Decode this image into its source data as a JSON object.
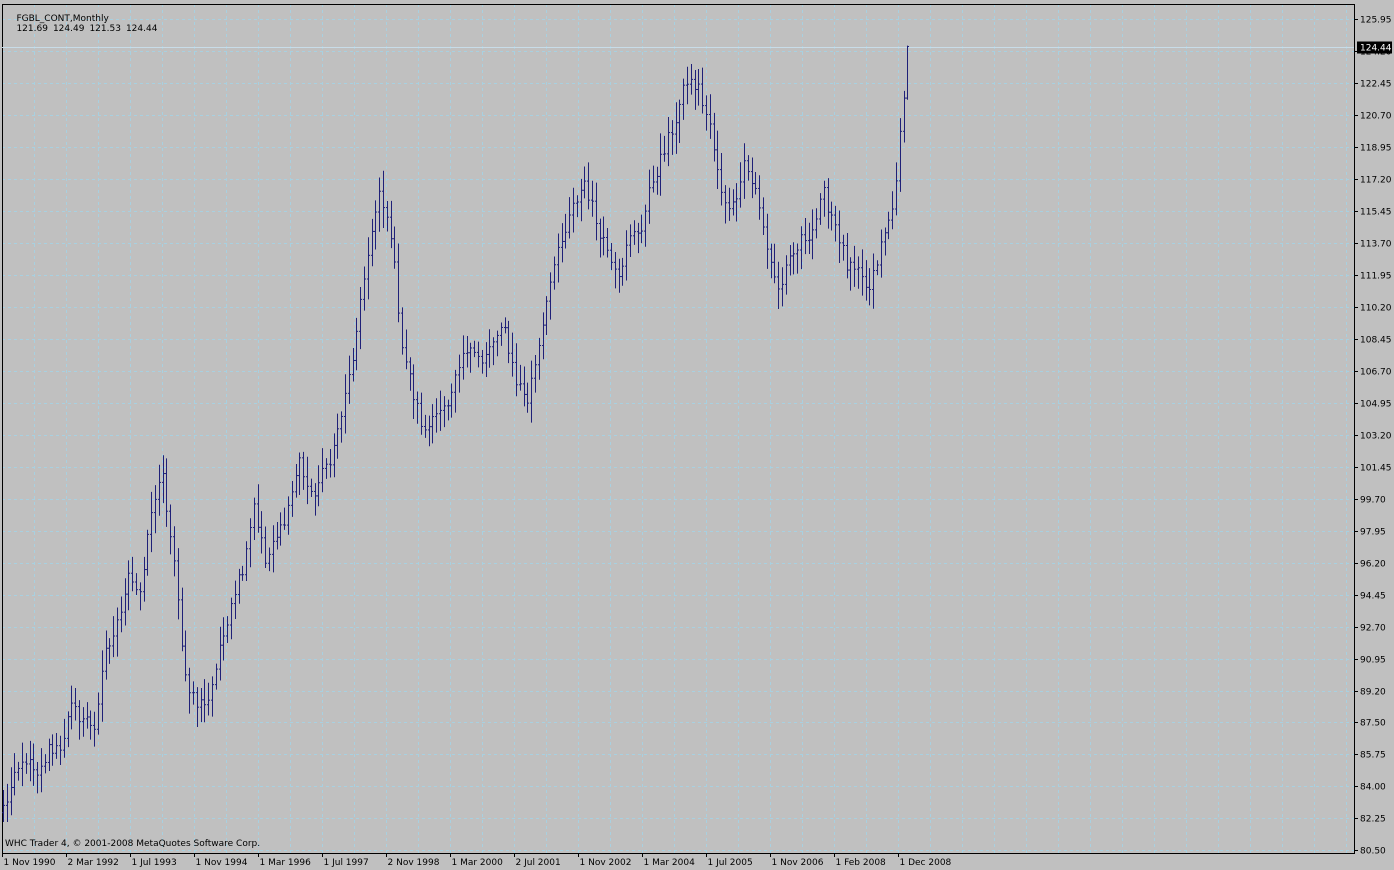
{
  "header": {
    "symbol": "FGBL_CONT,Monthly",
    "open": "121.69",
    "high": "124.49",
    "low": "121.53",
    "close": "124.44"
  },
  "footer": {
    "copyright": "WHC Trader 4, © 2001-2008 MetaQuotes Software Corp."
  },
  "colors": {
    "background": "#c0c0c0",
    "grid": "#a8d0e0",
    "bars": "#1f2078",
    "axis": "#000000",
    "price_line": "#c8dce8",
    "price_tag_bg": "#000000",
    "price_tag_text": "#ffffff"
  },
  "chart_data": {
    "type": "ohlc-bar",
    "timeframe": "Monthly",
    "current_price": "124.44",
    "ylim": [
      80.5,
      126.6
    ],
    "y_ticks": [
      "125.95",
      "124.20",
      "122.45",
      "120.70",
      "118.95",
      "117.20",
      "115.45",
      "113.70",
      "111.95",
      "110.20",
      "108.45",
      "106.70",
      "104.95",
      "103.20",
      "101.45",
      "99.70",
      "97.95",
      "96.20",
      "94.45",
      "92.70",
      "90.95",
      "89.20",
      "87.50",
      "85.75",
      "84.00",
      "82.25",
      "80.50"
    ],
    "x_ticks": [
      "1 Nov 1990",
      "2 Mar 1992",
      "1 Jul 1993",
      "1 Nov 1994",
      "1 Mar 1996",
      "1 Jul 1997",
      "2 Nov 1998",
      "1 Mar 2000",
      "2 Jul 2001",
      "1 Nov 2002",
      "1 Mar 2004",
      "1 Jul 2005",
      "1 Nov 2006",
      "1 Feb 2008",
      "1 Dec 2008"
    ],
    "grid": true,
    "grid_style": "dashed",
    "anchors": [
      [
        0,
        82.8
      ],
      [
        4,
        84.8
      ],
      [
        6,
        85.5
      ],
      [
        9,
        84.3
      ],
      [
        12,
        86.0
      ],
      [
        15,
        86.2
      ],
      [
        18,
        88.2
      ],
      [
        21,
        87.7
      ],
      [
        24,
        87.3
      ],
      [
        27,
        91.2
      ],
      [
        30,
        92.8
      ],
      [
        33,
        95.8
      ],
      [
        36,
        94.2
      ],
      [
        39,
        99.2
      ],
      [
        42,
        100.8
      ],
      [
        45,
        96.0
      ],
      [
        48,
        90.0
      ],
      [
        51,
        88.4
      ],
      [
        54,
        88.8
      ],
      [
        57,
        91.3
      ],
      [
        60,
        94.2
      ],
      [
        63,
        96.0
      ],
      [
        66,
        99.5
      ],
      [
        69,
        96.2
      ],
      [
        72,
        97.5
      ],
      [
        75,
        99.3
      ],
      [
        78,
        101.8
      ],
      [
        81,
        99.7
      ],
      [
        84,
        101.0
      ],
      [
        87,
        102.5
      ],
      [
        90,
        105.2
      ],
      [
        93,
        108.6
      ],
      [
        96,
        113.3
      ],
      [
        99,
        116.2
      ],
      [
        102,
        114.3
      ],
      [
        105,
        108.2
      ],
      [
        108,
        105.3
      ],
      [
        111,
        103.2
      ],
      [
        114,
        104.8
      ],
      [
        117,
        104.5
      ],
      [
        120,
        106.8
      ],
      [
        123,
        108.4
      ],
      [
        126,
        107.0
      ],
      [
        129,
        108.3
      ],
      [
        132,
        108.9
      ],
      [
        135,
        106.2
      ],
      [
        138,
        105.1
      ],
      [
        141,
        108.2
      ],
      [
        144,
        111.9
      ],
      [
        147,
        113.6
      ],
      [
        150,
        115.6
      ],
      [
        153,
        117.1
      ],
      [
        156,
        114.9
      ],
      [
        159,
        113.4
      ],
      [
        162,
        112.2
      ],
      [
        165,
        113.9
      ],
      [
        168,
        114.6
      ],
      [
        171,
        117.2
      ],
      [
        174,
        118.7
      ],
      [
        177,
        120.5
      ],
      [
        180,
        122.6
      ],
      [
        183,
        122.1
      ],
      [
        186,
        120.0
      ],
      [
        189,
        116.3
      ],
      [
        192,
        115.7
      ],
      [
        195,
        118.2
      ],
      [
        198,
        116.5
      ],
      [
        201,
        113.5
      ],
      [
        204,
        111.1
      ],
      [
        207,
        112.6
      ],
      [
        210,
        113.8
      ],
      [
        213,
        114.5
      ],
      [
        216,
        116.3
      ],
      [
        219,
        114.8
      ],
      [
        222,
        112.4
      ],
      [
        225,
        111.9
      ],
      [
        228,
        111.0
      ],
      [
        231,
        113.5
      ],
      [
        234,
        115.5
      ],
      [
        237,
        121.4
      ],
      [
        238,
        124.0
      ]
    ]
  }
}
